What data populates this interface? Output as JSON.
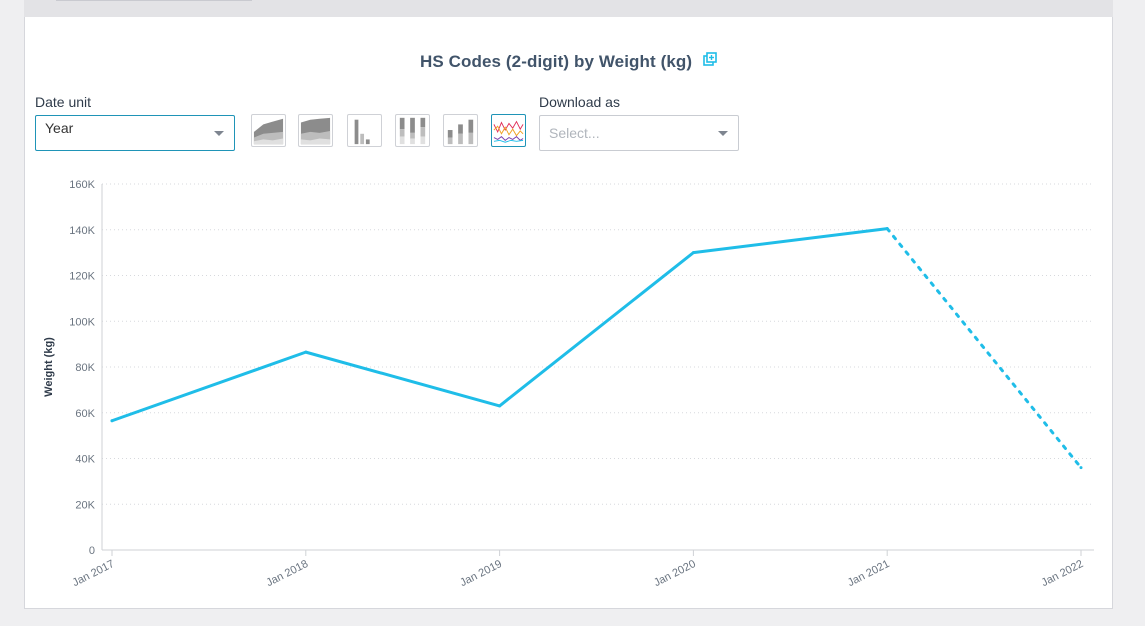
{
  "colors": {
    "accent": "#1fbde8",
    "border_active": "#1f94b7",
    "grid": "#d7d9dd"
  },
  "title": "HS Codes (2-digit) by Weight (kg)",
  "icons": {
    "copy": "copy-icon",
    "caret": "chevron-down-icon"
  },
  "date_unit": {
    "label": "Date unit",
    "value": "Year"
  },
  "chart_types": [
    {
      "name": "stacked-area-icon",
      "active": false
    },
    {
      "name": "percent-area-icon",
      "active": false
    },
    {
      "name": "bar-icon",
      "active": false
    },
    {
      "name": "stacked-bar-icon",
      "active": false
    },
    {
      "name": "grouped-bar-icon",
      "active": false
    },
    {
      "name": "multi-line-icon",
      "active": true
    }
  ],
  "download": {
    "label": "Download as",
    "placeholder": "Select..."
  },
  "chart_data": {
    "type": "line",
    "title": "HS Codes (2-digit) by Weight (kg)",
    "ylabel": "Weight (kg)",
    "xlabel": "",
    "categories": [
      "Jan 2017",
      "Jan 2018",
      "Jan 2019",
      "Jan 2020",
      "Jan 2021",
      "Jan 2022"
    ],
    "yticks": [
      "0",
      "20K",
      "40K",
      "60K",
      "80K",
      "100K",
      "120K",
      "140K",
      "160K"
    ],
    "ylim": [
      0,
      160000
    ],
    "grid": true,
    "series": [
      {
        "values": [
          56500,
          86500,
          63000,
          130000,
          140500,
          36000
        ],
        "dashed_from_index": 4
      }
    ]
  }
}
